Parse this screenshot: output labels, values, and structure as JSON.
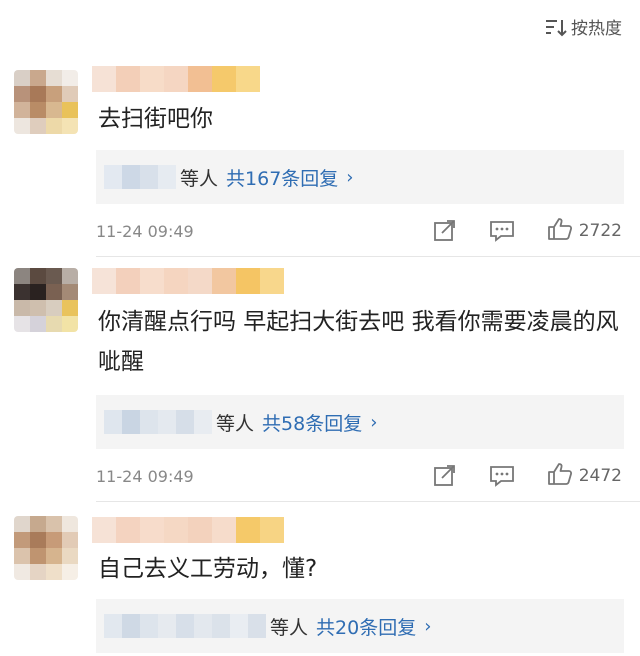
{
  "header": {
    "sort_label": "按热度",
    "sort_icon": "sort-icon"
  },
  "comments": [
    {
      "text": "去扫街吧你",
      "reply_suffix": "等人",
      "reply_count": "共167条回复",
      "time": "11-24 09:49",
      "likes": "2722"
    },
    {
      "text": "你清醒点行吗 早起扫大街去吧 我看你需要凌晨的风呲醒",
      "reply_suffix": "等人",
      "reply_count": "共58条回复",
      "time": "11-24 09:49",
      "likes": "2472"
    },
    {
      "text": "自己去义工劳动，懂?",
      "reply_suffix": "等人",
      "reply_count": "共20条回复"
    }
  ],
  "colors": {
    "link": "#2f6db3",
    "reply_bg": "#f4f4f4",
    "meta": "#888888"
  }
}
